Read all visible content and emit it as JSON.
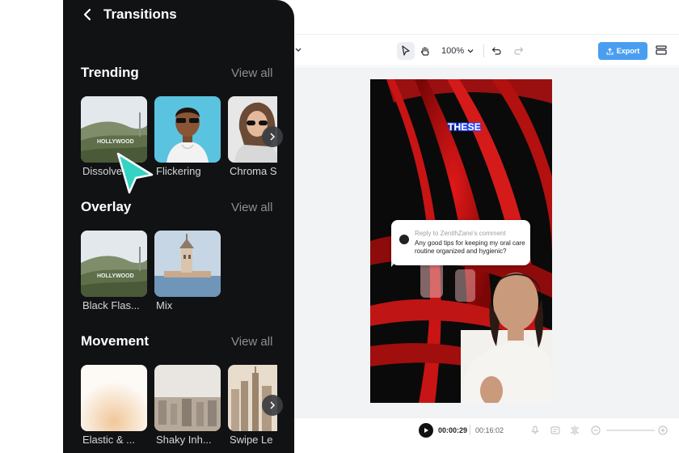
{
  "editor": {
    "zoom_level": "100%",
    "export_label": "Export",
    "video_caption": "THESE",
    "reply": {
      "header": "Reply to ZenithZane's comment",
      "text": "Any good tips for keeping my oral care routine organized and hygienic?"
    },
    "playback": {
      "current_time": "00:00:29",
      "total_time": "00:16:02"
    },
    "accent_color": "#4a9ef0"
  },
  "panel": {
    "title": "Transitions",
    "sections": [
      {
        "title": "Trending",
        "view_all": "View all",
        "items": [
          {
            "label": "Dissolve",
            "icon": "hollywood-hills-thumbnail"
          },
          {
            "label": "Flickering",
            "icon": "man-sunglasses-thumbnail"
          },
          {
            "label": "Chroma S",
            "icon": "woman-sunglasses-thumbnail"
          }
        ]
      },
      {
        "title": "Overlay",
        "view_all": "View all",
        "items": [
          {
            "label": "Black Flas...",
            "icon": "hollywood-hills-thumbnail"
          },
          {
            "label": "Mix",
            "icon": "tower-sea-thumbnail"
          }
        ]
      },
      {
        "title": "Movement",
        "view_all": "View all",
        "items": [
          {
            "label": "Elastic & ...",
            "icon": "white-glow-thumbnail"
          },
          {
            "label": "Shaky Inh...",
            "icon": "city-blur-thumbnail"
          },
          {
            "label": "Swipe Le",
            "icon": "city-skyline-thumbnail"
          }
        ]
      }
    ],
    "cursor_color": "#34d3c3"
  }
}
